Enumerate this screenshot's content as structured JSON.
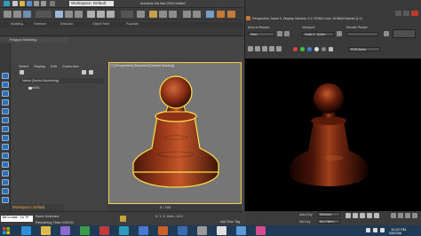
{
  "titlebar": {
    "workspace": "Workspace: Default",
    "title": "Autodesk 3ds Max 2016    Untitled",
    "search_placeholder": "Type a keyword or phrase"
  },
  "ribbon": {
    "tabs": [
      "Modeling",
      "Freeform",
      "Selection",
      "Object Paint",
      "Populate"
    ],
    "panel_label": "Polygon Modeling"
  },
  "explorer": {
    "tabs": [
      "Select",
      "Display",
      "Edit",
      "Customize"
    ],
    "header": "Name (Sorted Ascending)",
    "row": "Line001"
  },
  "viewport": {
    "label": "[+] [Perspective] [Standard] [Default Shading]",
    "frame": "0 / 100"
  },
  "workspace_bottom": "Workspace: Default",
  "status": {
    "maxscript": "Welcome to M",
    "line1": "None Selected",
    "line2": "Rendering Time 0:00:00",
    "coords": "X:            Y:            Z:            Grid = 10.0",
    "add_time_tag": "Add Time Tag"
  },
  "render_window": {
    "title": "Perspective, frame 0, Display Gamma: 2.2, RGBA Color 16 Bits/Channel (1:1)",
    "area_label": "Area to Render:",
    "area_value": "View",
    "viewport_label": "Viewport:",
    "viewport_value": "Quad 4 - Active",
    "preset_label": "Render Preset:",
    "rgb_value": "RGB Alpha",
    "auto_key": "Auto Key",
    "selected": "Selected",
    "set_key": "Set Key",
    "key_filters": "Key Filters..."
  },
  "taskbar": {
    "time": "10:22 PM",
    "date": "5/20/2016"
  }
}
